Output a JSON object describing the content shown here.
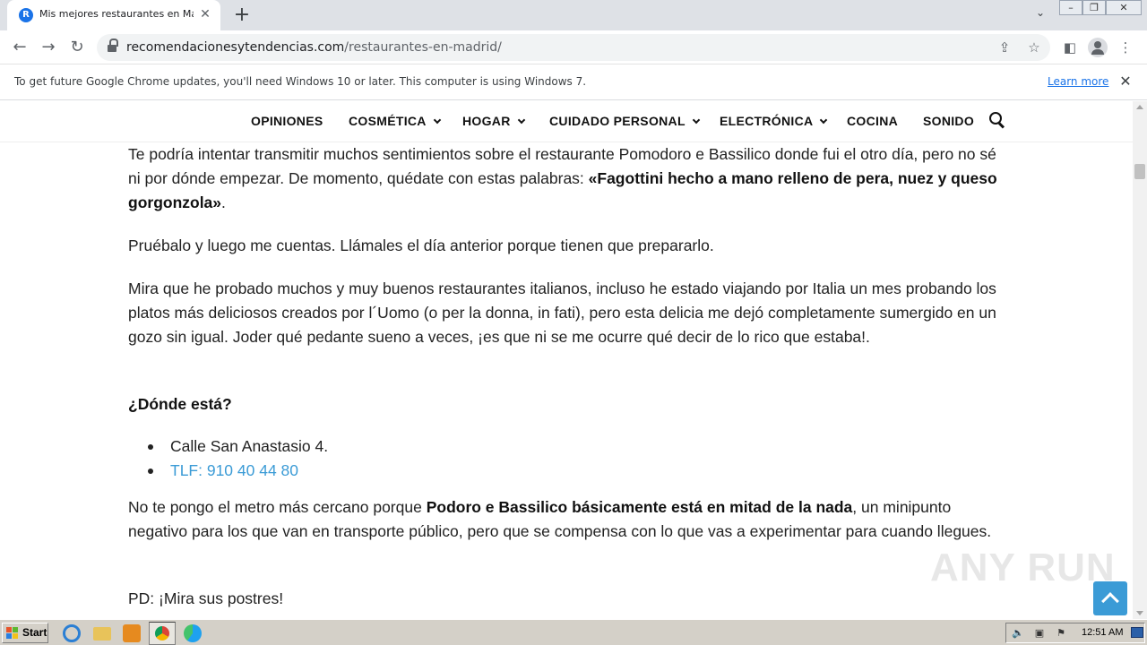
{
  "browser": {
    "tab_title": "Mis mejores restaurantes en Madrid",
    "url_domain": "recomendacionesytendencias.com",
    "url_path": "/restaurantes-en-madrid/",
    "icons": [
      "back-icon",
      "forward-icon",
      "reload-icon",
      "lock-icon",
      "share-icon",
      "star-icon",
      "sidepanel-icon",
      "profile-icon",
      "menu-icon"
    ]
  },
  "infobar": {
    "message": "To get future Google Chrome updates, you'll need Windows 10 or later. This computer is using Windows 7.",
    "link": "Learn more"
  },
  "site_nav": {
    "items": [
      {
        "label": "OPINIONES",
        "has_dropdown": false
      },
      {
        "label": "COSMÉTICA",
        "has_dropdown": true
      },
      {
        "label": "HOGAR",
        "has_dropdown": true
      },
      {
        "label": "CUIDADO PERSONAL",
        "has_dropdown": true
      },
      {
        "label": "ELECTRÓNICA",
        "has_dropdown": true
      },
      {
        "label": "COCINA",
        "has_dropdown": false
      },
      {
        "label": "SONIDO",
        "has_dropdown": false
      }
    ]
  },
  "article": {
    "p1_text": "Te podría intentar transmitir muchos sentimientos sobre el restaurante Pomodoro e Bassilico donde fui el otro día, pero no sé ni por dónde empezar. De momento, quédate con estas palabras: ",
    "p1_bold": "«Fagottini hecho a mano relleno de pera, nuez y queso gorgonzola»",
    "p1_end": ".",
    "p2": "Pruébalo y luego me cuentas. Llámales el día anterior porque tienen que prepararlo.",
    "p3": "Mira que he probado muchos y muy buenos restaurantes italianos, incluso he estado viajando por Italia un mes probando los platos más deliciosos creados por l´Uomo (o per la donna, in fati), pero esta delicia me dejó completamente sumergido en un gozo sin igual. Joder qué pedante sueno a veces, ¡es que ni se me ocurre qué decir de lo rico que estaba!.",
    "heading": "¿Dónde está?",
    "address": "Calle San Anastasio 4.",
    "phone": "TLF: 910 40 44 80",
    "p4_start": "No te pongo el metro más cercano porque ",
    "p4_bold": "Podoro e Bassilico básicamente está en mitad de la nada",
    "p4_end": ", un minipunto negativo para los que van en transporte público, pero que se compensa con lo que vas a experimentar para cuando llegues.",
    "p5": "PD: ¡Mira sus postres!"
  },
  "watermark": "ANY RUN",
  "taskbar": {
    "start_label": "Start",
    "clock": "12:51 AM"
  },
  "colors": {
    "link_blue": "#3b9bd6",
    "chrome_link": "#1a73e8",
    "taskbar": "#d4d0c8"
  }
}
